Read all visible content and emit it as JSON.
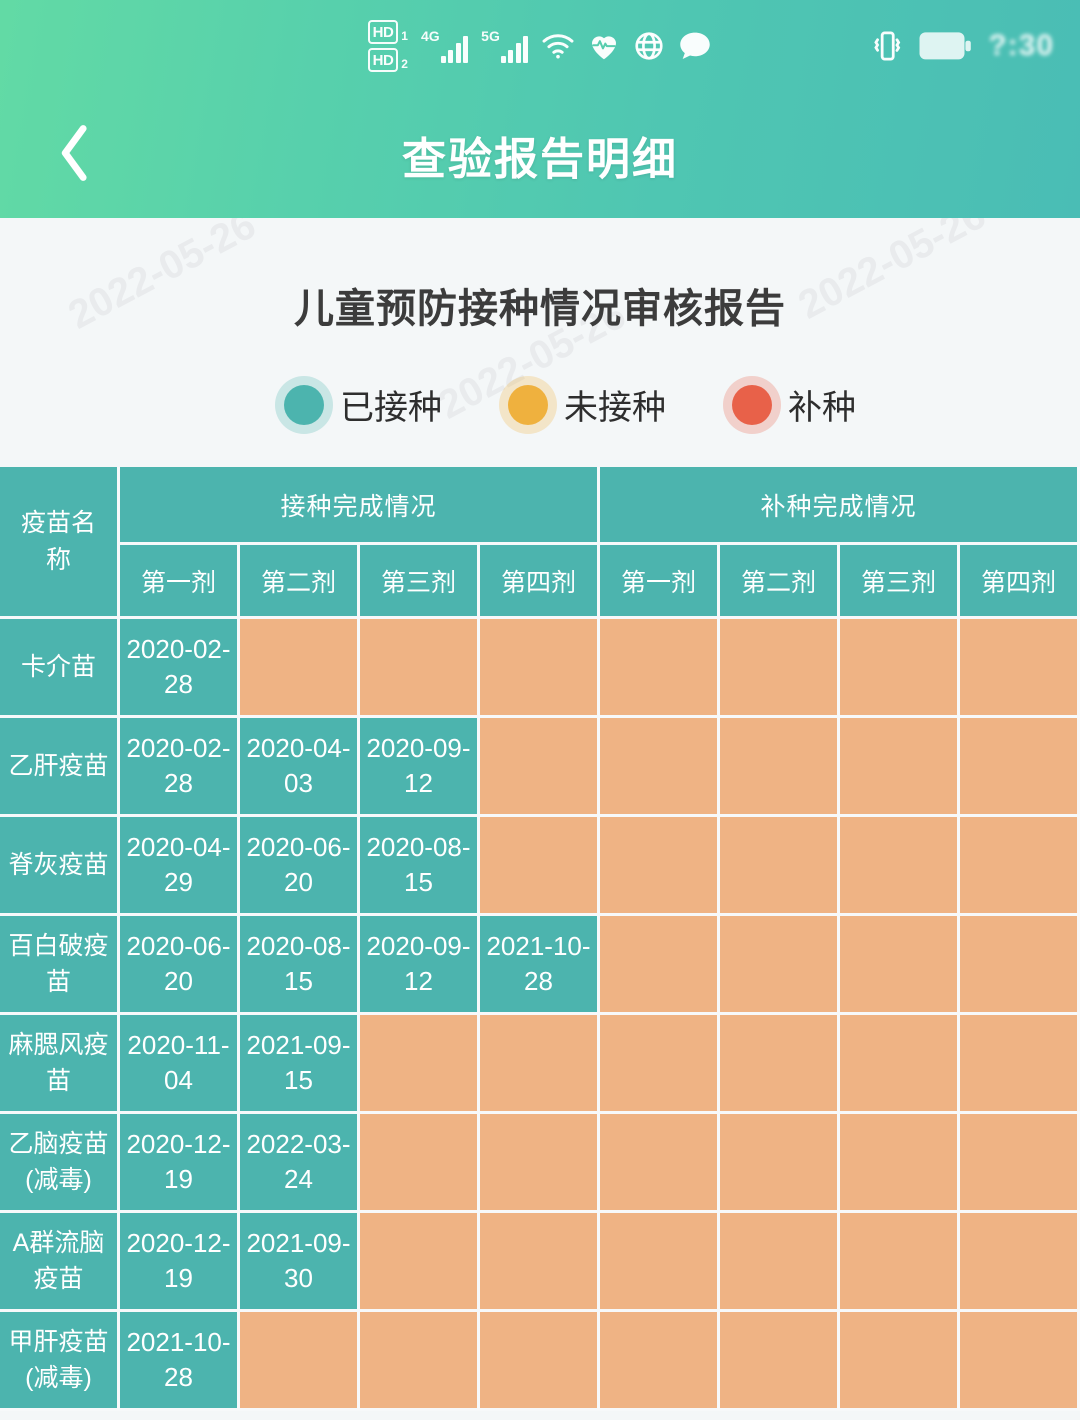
{
  "status_bar": {
    "hd1_label": "HD",
    "hd1_index": "1",
    "hd2_label": "HD",
    "hd2_index": "2",
    "net1_label": "4G",
    "net2_label": "5G",
    "icons": [
      "hd1-icon",
      "hd2-icon",
      "signal-4g-icon",
      "signal-5g-icon",
      "wifi-icon",
      "heartbeat-icon",
      "globe-icon",
      "message-bubble-icon",
      "vibrate-icon",
      "battery-icon"
    ],
    "time": "?:30"
  },
  "nav": {
    "back_icon": "chevron-left-icon",
    "title": "查验报告明细"
  },
  "report": {
    "title": "儿童预防接种情况审核报告",
    "watermark": "2022-05-26"
  },
  "legend": {
    "items": [
      {
        "label": "已接种",
        "color": "#4CB4AE",
        "name": "vaccinated"
      },
      {
        "label": "未接种",
        "color": "#EFB13F",
        "name": "not-vaccinated"
      },
      {
        "label": "补种",
        "color": "#E8624A",
        "name": "catch-up"
      }
    ]
  },
  "table": {
    "name_header": "疫苗名称",
    "group_headers": [
      "接种完成情况",
      "补种完成情况"
    ],
    "dose_headers": [
      "第一剂",
      "第二剂",
      "第三剂",
      "第四剂"
    ],
    "rows": [
      {
        "vaccine": "卡介苗",
        "doses": [
          "2020-02-28",
          "",
          "",
          ""
        ],
        "makeup": [
          "",
          "",
          "",
          ""
        ]
      },
      {
        "vaccine": "乙肝疫苗",
        "doses": [
          "2020-02-28",
          "2020-04-03",
          "2020-09-12",
          ""
        ],
        "makeup": [
          "",
          "",
          "",
          ""
        ]
      },
      {
        "vaccine": "脊灰疫苗",
        "doses": [
          "2020-04-29",
          "2020-06-20",
          "2020-08-15",
          ""
        ],
        "makeup": [
          "",
          "",
          "",
          ""
        ]
      },
      {
        "vaccine": "百白破疫苗",
        "doses": [
          "2020-06-20",
          "2020-08-15",
          "2020-09-12",
          "2021-10-28"
        ],
        "makeup": [
          "",
          "",
          "",
          ""
        ]
      },
      {
        "vaccine": "麻腮风疫苗",
        "doses": [
          "2020-11-04",
          "2021-09-15",
          "",
          ""
        ],
        "makeup": [
          "",
          "",
          "",
          ""
        ]
      },
      {
        "vaccine": "乙脑疫苗(减毒)",
        "doses": [
          "2020-12-19",
          "2022-03-24",
          "",
          ""
        ],
        "makeup": [
          "",
          "",
          "",
          ""
        ]
      },
      {
        "vaccine": "A群流脑疫苗",
        "doses": [
          "2020-12-19",
          "2021-09-30",
          "",
          ""
        ],
        "makeup": [
          "",
          "",
          "",
          ""
        ]
      },
      {
        "vaccine": "甲肝疫苗(减毒)",
        "doses": [
          "2021-10-28",
          "",
          "",
          ""
        ],
        "makeup": [
          "",
          "",
          "",
          ""
        ]
      }
    ]
  },
  "colors": {
    "teal": "#4CB4AE",
    "orange": "#EFB384",
    "red": "#E8624A",
    "header_gradient_start": "#62DAA5",
    "header_gradient_end": "#4ABDB5",
    "page_bg": "#f4f7f8"
  }
}
